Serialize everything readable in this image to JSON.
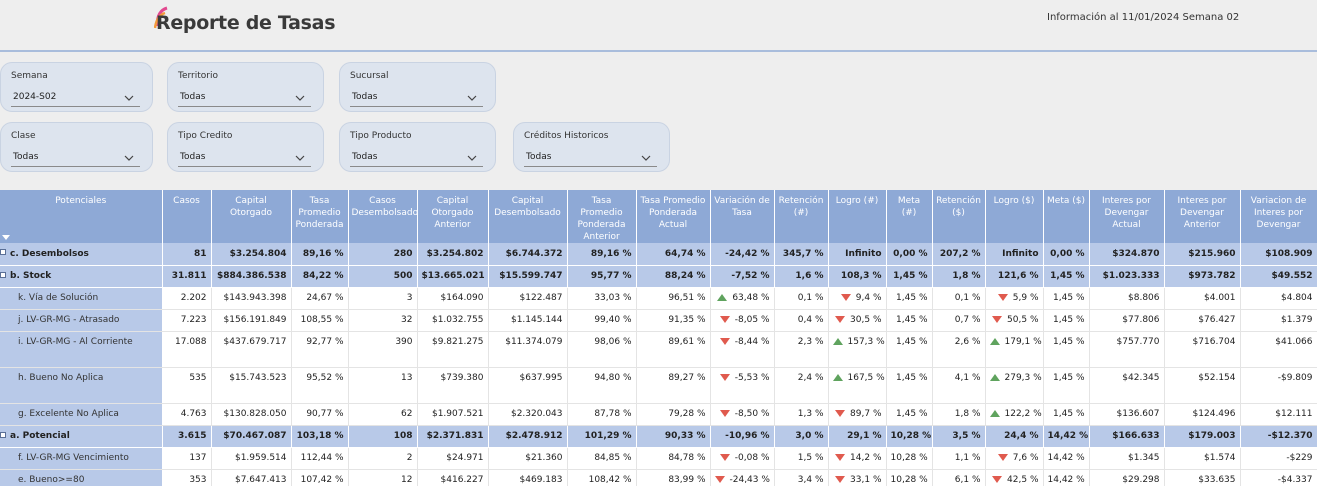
{
  "header": {
    "title": "Reporte de Tasas",
    "info": "Información al 11/01/2024 Semana 02"
  },
  "filters": [
    {
      "label": "Semana",
      "value": "2024-S02"
    },
    {
      "label": "Territorio",
      "value": "Todas"
    },
    {
      "label": "Sucursal",
      "value": "Todas"
    },
    {
      "label": "Clase",
      "value": "Todas"
    },
    {
      "label": "Tipo Credito",
      "value": "Todas"
    },
    {
      "label": "Tipo Producto",
      "value": "Todas"
    },
    {
      "label": "Créditos Historicos",
      "value": "Todas"
    }
  ],
  "table": {
    "columns": [
      "Potenciales",
      "Casos",
      "Capital Otorgado",
      "Tasa Promedio Ponderada",
      "Casos Desembolsados",
      "Capital Otorgado Anterior",
      "Capital Desembolsado",
      "Tasa Promedio Ponderada Anterior",
      "Tasa Promedio Ponderada Actual",
      "Variación de Tasa",
      "Retención (#)",
      "Logro (#)",
      "Meta (#)",
      "Retención ($)",
      "Logro ($)",
      "Meta ($)",
      "Interes por Devengar Actual",
      "Interes por Devengar Anterior",
      "Variacion de Interes por Devengar"
    ],
    "rows": [
      {
        "group": true,
        "cells": [
          "c. Desembolsos",
          "81",
          "$3.254.804",
          "89,16 %",
          "280",
          "$3.254.802",
          "$6.744.372",
          "89,16 %",
          "64,74 %",
          "-24,42 %",
          "345,7 %",
          "Infinito",
          "0,00 %",
          "207,2 %",
          "Infinito",
          "0,00 %",
          "$324.870",
          "$215.960",
          "$108.909"
        ]
      },
      {
        "group": true,
        "cells": [
          "b. Stock",
          "31.811",
          "$884.386.538",
          "84,22 %",
          "500",
          "$13.665.021",
          "$15.599.747",
          "95,77 %",
          "88,24 %",
          "-7,52 %",
          "1,6 %",
          "108,3 %",
          "1,45 %",
          "1,8 %",
          "121,6 %",
          "1,45 %",
          "$1.023.333",
          "$973.782",
          "$49.552"
        ]
      },
      {
        "cells": [
          "k. Vía de Solución",
          "2.202",
          "$143.943.398",
          "24,67 %",
          "3",
          "$164.090",
          "$122.487",
          "33,03 %",
          "96,51 %",
          "63,48 %",
          "0,1 %",
          "9,4 %",
          "1,45 %",
          "0,1 %",
          "5,9 %",
          "1,45 %",
          "$8.806",
          "$4.001",
          "$4.804"
        ],
        "ind": {
          "var": "up",
          "logro_n": "down",
          "logro_d": "down"
        }
      },
      {
        "cells": [
          "j. LV-GR-MG - Atrasado",
          "7.223",
          "$156.191.849",
          "108,55 %",
          "32",
          "$1.032.755",
          "$1.145.144",
          "99,40 %",
          "91,35 %",
          "-8,05 %",
          "0,4 %",
          "30,5 %",
          "1,45 %",
          "0,7 %",
          "50,5 %",
          "1,45 %",
          "$77.806",
          "$76.427",
          "$1.379"
        ],
        "ind": {
          "var": "down",
          "logro_n": "down",
          "logro_d": "down"
        }
      },
      {
        "tall": true,
        "cells": [
          "i. LV-GR-MG - Al Corriente",
          "17.088",
          "$437.679.717",
          "92,77 %",
          "390",
          "$9.821.275",
          "$11.374.079",
          "98,06 %",
          "89,61 %",
          "-8,44 %",
          "2,3 %",
          "157,3 %",
          "1,45 %",
          "2,6 %",
          "179,1 %",
          "1,45 %",
          "$757.770",
          "$716.704",
          "$41.066"
        ],
        "ind": {
          "var": "down",
          "logro_n": "up",
          "logro_d": "up"
        }
      },
      {
        "tall": true,
        "cells": [
          "h. Bueno No Aplica",
          "535",
          "$15.743.523",
          "95,52 %",
          "13",
          "$739.380",
          "$637.995",
          "94,80 %",
          "89,27 %",
          "-5,53 %",
          "2,4 %",
          "167,5 %",
          "1,45 %",
          "4,1 %",
          "279,3 %",
          "1,45 %",
          "$42.345",
          "$52.154",
          "-$9.809"
        ],
        "ind": {
          "var": "down",
          "logro_n": "up",
          "logro_d": "up"
        }
      },
      {
        "cells": [
          "g. Excelente No Aplica",
          "4.763",
          "$130.828.050",
          "90,77 %",
          "62",
          "$1.907.521",
          "$2.320.043",
          "87,78 %",
          "79,28 %",
          "-8,50 %",
          "1,3 %",
          "89,7 %",
          "1,45 %",
          "1,8 %",
          "122,2 %",
          "1,45 %",
          "$136.607",
          "$124.496",
          "$12.111"
        ],
        "ind": {
          "var": "down",
          "logro_n": "down",
          "logro_d": "up"
        }
      },
      {
        "group": true,
        "cells": [
          "a. Potencial",
          "3.615",
          "$70.467.087",
          "103,18 %",
          "108",
          "$2.371.831",
          "$2.478.912",
          "101,29 %",
          "90,33 %",
          "-10,96 %",
          "3,0 %",
          "29,1 %",
          "10,28 %",
          "3,5 %",
          "24,4 %",
          "14,42 %",
          "$166.633",
          "$179.003",
          "-$12.370"
        ]
      },
      {
        "cells": [
          "f. LV-GR-MG Vencimiento",
          "137",
          "$1.959.514",
          "112,44 %",
          "2",
          "$24.971",
          "$21.360",
          "84,85 %",
          "84,78 %",
          "-0,08 %",
          "1,5 %",
          "14,2 %",
          "10,28 %",
          "1,1 %",
          "7,6 %",
          "14,42 %",
          "$1.345",
          "$1.574",
          "-$229"
        ],
        "ind": {
          "var": "down",
          "logro_n": "down",
          "logro_d": "down"
        }
      },
      {
        "cells": [
          "e. Bueno>=80",
          "353",
          "$7.647.413",
          "107,42 %",
          "12",
          "$416.227",
          "$469.183",
          "108,42 %",
          "83,99 %",
          "-24,43 %",
          "3,4 %",
          "33,1 %",
          "10,28 %",
          "6,1 %",
          "42,5 %",
          "14,42 %",
          "$29.298",
          "$33.635",
          "-$4.337"
        ],
        "ind": {
          "var": "down",
          "logro_n": "down",
          "logro_d": "down"
        }
      }
    ]
  },
  "colors": {
    "header_blue": "#8ea9d6",
    "group_blue": "#b8c9e8",
    "down": "#e05a4e",
    "up": "#5fa35e"
  }
}
